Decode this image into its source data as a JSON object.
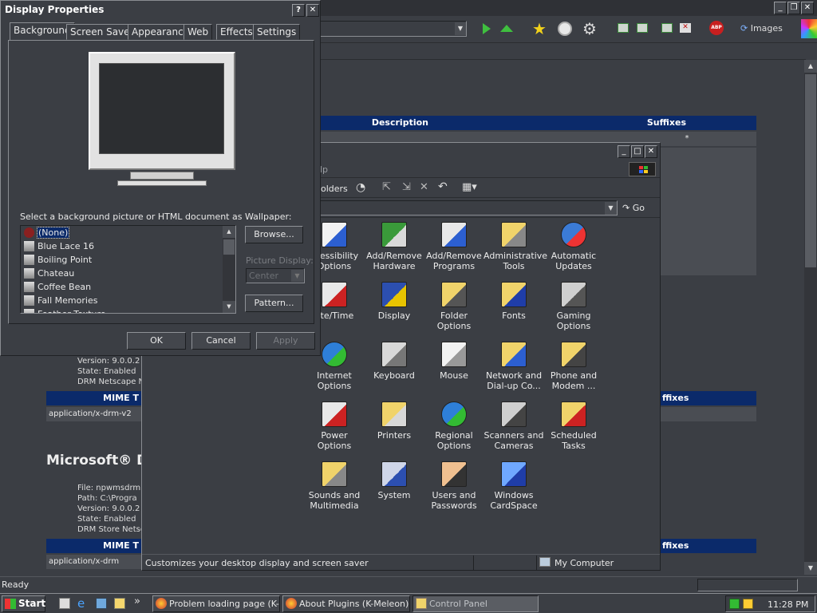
{
  "colors": {
    "accent": "#0b2a6a",
    "bg": "#3b3e44",
    "panel": "#4a4d53"
  },
  "browser": {
    "status": "Ready",
    "toolbar": {
      "images_label": "Images"
    },
    "table": {
      "col_description": "Description",
      "col_suffixes": "Suffixes",
      "asterisk": "*",
      "mime_label": "MIME T",
      "suffixes_label2": "ffixes",
      "suffixes_label3": "ffixes"
    },
    "plugin1": {
      "version": "Version: 9.0.0.2",
      "state": "State: Enabled",
      "desc": "DRM Netscape N",
      "mime": "application/x-drm-v2"
    },
    "plugin2": {
      "title": "Microsoft® D",
      "file": "File: npwmsdrm.",
      "path": "Path: C:\\Progra",
      "version": "Version: 9.0.0.2",
      "state": "State: Enabled",
      "desc": "DRM Store Netsc",
      "mime": "application/x-drm"
    }
  },
  "display_properties": {
    "title": "Display Properties",
    "tabs": [
      "Background",
      "Screen Saver",
      "Appearance",
      "Web",
      "Effects",
      "Settings"
    ],
    "wallpaper_label": "Select a background picture or HTML document as Wallpaper:",
    "wallpapers": [
      "(None)",
      "Blue Lace 16",
      "Boiling Point",
      "Chateau",
      "Coffee Bean",
      "Fall Memories",
      "Feather Texture"
    ],
    "browse": "Browse...",
    "picture_display_label": "Picture Display:",
    "picture_display_value": "Center",
    "pattern": "Pattern...",
    "ok": "OK",
    "cancel": "Cancel",
    "apply": "Apply"
  },
  "control_panel": {
    "address_hint": "lp",
    "folders_label": "olders",
    "go": "Go",
    "status_left": "Customizes your desktop display and screen saver",
    "status_right": "My Computer",
    "items": [
      {
        "label": "ccessibility\nOptions",
        "icon": "accessibility-icon"
      },
      {
        "label": "Add/Remove\nHardware",
        "icon": "add-hardware-icon"
      },
      {
        "label": "Add/Remove\nPrograms",
        "icon": "add-programs-icon"
      },
      {
        "label": "Administrative\nTools",
        "icon": "admin-tools-icon"
      },
      {
        "label": "Automatic\nUpdates",
        "icon": "windows-update-icon"
      },
      {
        "label": "ate/Time",
        "icon": "date-time-icon"
      },
      {
        "label": "Display",
        "icon": "display-icon"
      },
      {
        "label": "Folder Options",
        "icon": "folder-options-icon"
      },
      {
        "label": "Fonts",
        "icon": "fonts-icon"
      },
      {
        "label": "Gaming\nOptions",
        "icon": "gaming-icon"
      },
      {
        "label": "Internet\nOptions",
        "icon": "internet-options-icon"
      },
      {
        "label": "Keyboard",
        "icon": "keyboard-icon"
      },
      {
        "label": "Mouse",
        "icon": "mouse-icon"
      },
      {
        "label": "Network and\nDial-up Co...",
        "icon": "network-icon"
      },
      {
        "label": "Phone and\nModem ...",
        "icon": "phone-icon"
      },
      {
        "label": "Power Options",
        "icon": "power-icon"
      },
      {
        "label": "Printers",
        "icon": "printer-icon"
      },
      {
        "label": "Regional\nOptions",
        "icon": "globe-icon"
      },
      {
        "label": "Scanners and\nCameras",
        "icon": "scanner-icon"
      },
      {
        "label": "Scheduled\nTasks",
        "icon": "scheduled-tasks-icon"
      },
      {
        "label": "Sounds and\nMultimedia",
        "icon": "speaker-icon"
      },
      {
        "label": "System",
        "icon": "system-icon"
      },
      {
        "label": "Users and\nPasswords",
        "icon": "users-icon"
      },
      {
        "label": "Windows\nCardSpace",
        "icon": "cardspace-icon"
      }
    ]
  },
  "taskbar": {
    "start": "Start",
    "chevron": "»",
    "tasks": [
      "Problem loading page (K-...",
      "About Plugins (K-Meleon)",
      "Control Panel"
    ],
    "clock": "11:28 PM"
  }
}
